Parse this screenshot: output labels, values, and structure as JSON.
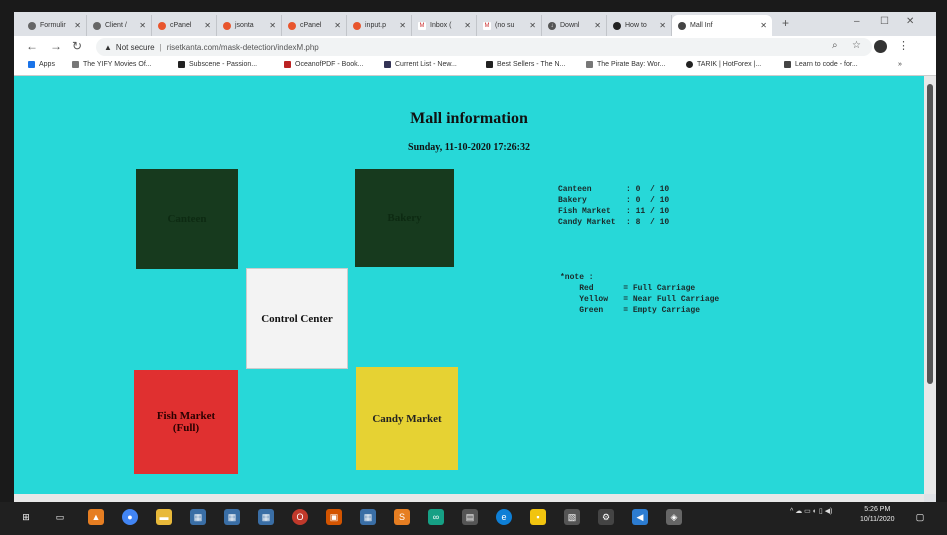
{
  "tabs": [
    {
      "label": "Formulir",
      "active": false
    },
    {
      "label": "Client /",
      "active": false
    },
    {
      "label": "cPanel",
      "active": false
    },
    {
      "label": "jsonta",
      "active": false
    },
    {
      "label": "cPanel",
      "active": false
    },
    {
      "label": "input.p",
      "active": false
    },
    {
      "label": "Inbox (",
      "active": false
    },
    {
      "label": "(no su",
      "active": false
    },
    {
      "label": "Downl",
      "active": false
    },
    {
      "label": "How to",
      "active": false
    },
    {
      "label": "Mall Inf",
      "active": true
    }
  ],
  "address_bar": {
    "security": "Not secure",
    "url": "risetkanta.com/mask-detection/indexM.php"
  },
  "bookmarks": [
    "Apps",
    "The YIFY Movies Of...",
    "Subscene - Passion...",
    "OceanofPDF - Book...",
    "Current List - New...",
    "Best Sellers - The N...",
    "The Pirate Bay: Wor...",
    "TARIK | HotForex |...",
    "Learn to code - for..."
  ],
  "page": {
    "title": "Mall information",
    "datetime": "Sunday, 11-10-2020 17:26:32",
    "stores": {
      "canteen": "Canteen",
      "bakery": "Bakery",
      "control_center": "Control Center",
      "fish_market": "Fish Market",
      "fish_market_status": "(Full)",
      "candy_market": "Candy Market"
    },
    "occupancy": [
      {
        "name": "Canteen",
        "count": "0",
        "capacity": "10"
      },
      {
        "name": "Bakery",
        "count": "0",
        "capacity": "10"
      },
      {
        "name": "Fish Market",
        "count": "11",
        "capacity": "10"
      },
      {
        "name": "Candy Market",
        "count": "8",
        "capacity": "10"
      }
    ],
    "note": {
      "heading": "*note :",
      "items": [
        {
          "color": "Red",
          "meaning": "Full Carriage"
        },
        {
          "color": "Yellow",
          "meaning": "Near Full Carriage"
        },
        {
          "color": "Green",
          "meaning": "Empty Carriage"
        }
      ]
    },
    "colors": {
      "background": "#27d8d8",
      "dark": "#173a1e",
      "red": "#e03030",
      "yellow": "#e6d233",
      "white": "#f3f3f3"
    }
  },
  "taskbar": {
    "time": "5:26 PM",
    "date": "10/11/2020"
  }
}
